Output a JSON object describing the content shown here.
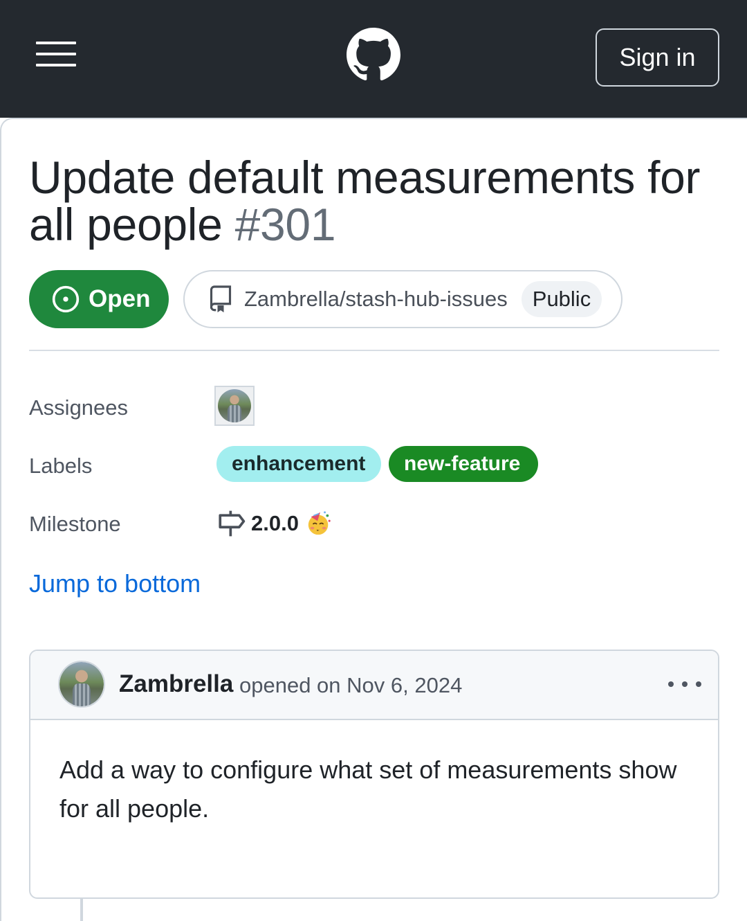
{
  "header": {
    "menu_icon": "hamburger-icon",
    "logo_icon": "github-mark-icon",
    "signin_label": "Sign in"
  },
  "issue": {
    "title": "Update default measurements for all people",
    "number": "#301",
    "state": "Open",
    "state_icon": "issue-opened-icon",
    "state_color": "#1f883d",
    "repo": "Zambrella/stash-hub-issues",
    "repo_icon": "repo-icon",
    "visibility": "Public"
  },
  "meta": {
    "assignees_label": "Assignees",
    "labels_label": "Labels",
    "milestone_label": "Milestone",
    "labels": [
      {
        "name": "enhancement",
        "color": "#a2eeef"
      },
      {
        "name": "new-feature",
        "color": "#1a8a24"
      }
    ],
    "milestone": "2.0.0",
    "milestone_icon": "milestone-icon",
    "milestone_emoji": "partying-face-emoji"
  },
  "jump_link": "Jump to bottom",
  "comment": {
    "author": "Zambrella",
    "meta": "opened on Nov 6, 2024",
    "more_icon": "kebab-horizontal-icon",
    "body": "Add a way to configure what set of measurements show for all people."
  }
}
